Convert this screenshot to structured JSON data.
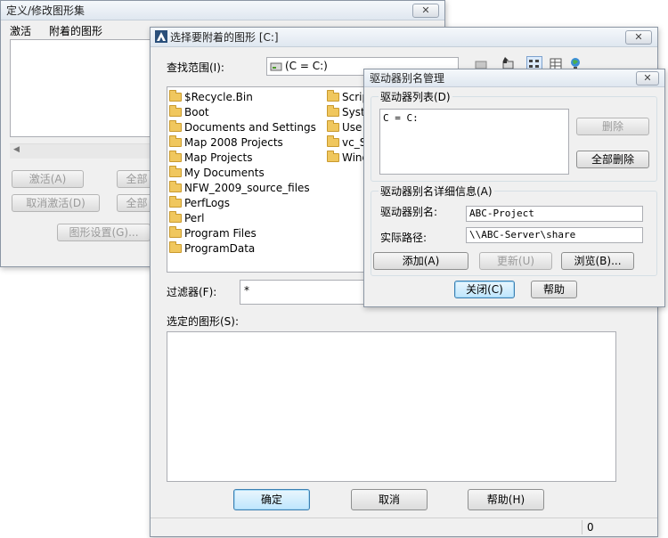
{
  "back_window": {
    "title": "定义/修改图形集",
    "col_active": "激活",
    "col_drawing": "附着的图形",
    "activate_btn": "激活(A)",
    "deactivate_btn": "取消激活(D)",
    "all_btn_1": "全部",
    "all_btn_2": "全部",
    "drawing_settings_btn": "图形设置(G)..."
  },
  "select_window": {
    "title": "选择要附着的图形 [C:]",
    "look_in_label": "查找范围(I):",
    "look_in_value": "(C = C:)",
    "folders_col1": [
      "$Recycle.Bin",
      "Boot",
      "Documents and Settings",
      "Map 2008 Projects",
      "Map Projects",
      "My Documents",
      "NFW_2009_source_files",
      "PerfLogs",
      "Perl",
      "Program Files",
      "ProgramData"
    ],
    "folders_col2": [
      "Scrip",
      "Syst",
      "Use",
      "vc_S",
      "Wind"
    ],
    "filter_label": "过滤器(F):",
    "filter_value": "*",
    "selected_label": "选定的图形(S):",
    "ok_btn": "确定",
    "cancel_btn": "取消",
    "help_btn": "帮助(H)",
    "status_count": "0"
  },
  "drive_alias_window": {
    "title": "驱动器别名管理",
    "list_group_title": "驱动器列表(D)",
    "list_items": [
      "C = C:"
    ],
    "delete_btn": "删除",
    "delete_all_btn": "全部删除",
    "detail_group_title": "驱动器别名详细信息(A)",
    "alias_label": "驱动器别名:",
    "alias_value": "ABC-Project",
    "path_label": "实际路径:",
    "path_value": "\\\\ABC-Server\\share",
    "add_btn": "添加(A)",
    "update_btn": "更新(U)",
    "browse_btn": "浏览(B)...",
    "close_btn": "关闭(C)",
    "help_btn": "帮助"
  }
}
